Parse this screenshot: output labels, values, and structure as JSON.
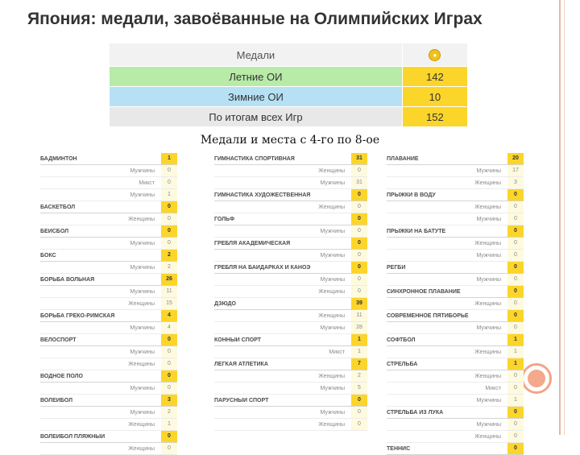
{
  "title": "Япония: медали, завоёванные на Олимпийских Играх",
  "summary": {
    "header": "Медали",
    "header_icon": "gold-medal-icon",
    "rows": [
      {
        "label": "Летние ОИ",
        "value": "142"
      },
      {
        "label": "Зимние ОИ",
        "value": "10"
      },
      {
        "label": "По итогам всех Игр",
        "value": "152"
      }
    ]
  },
  "subtitle": "Медали и места с 4-го по 8-ое",
  "columns": [
    [
      {
        "name": "Бадминтон",
        "value": "1"
      },
      {
        "name": "Мужчины",
        "value": "0"
      },
      {
        "name": "Микст",
        "value": "0"
      },
      {
        "name": "Мужчины",
        "value": "1"
      },
      {
        "name": "Баскетбол",
        "value": "0"
      },
      {
        "name": "Женщины",
        "value": "0"
      },
      {
        "name": "Бейсбол",
        "value": "0"
      },
      {
        "name": "Мужчины",
        "value": "0"
      },
      {
        "name": "Бокс",
        "value": "2"
      },
      {
        "name": "Мужчины",
        "value": "2"
      },
      {
        "name": "Борьба вольная",
        "value": "26"
      },
      {
        "name": "Мужчины",
        "value": "11"
      },
      {
        "name": "Женщины",
        "value": "15"
      },
      {
        "name": "Борьба греко-римская",
        "value": "4"
      },
      {
        "name": "Мужчины",
        "value": "4"
      },
      {
        "name": "Велоспорт",
        "value": "0"
      },
      {
        "name": "Мужчины",
        "value": "0"
      },
      {
        "name": "Женщины",
        "value": "0"
      },
      {
        "name": "Водное поло",
        "value": "0"
      },
      {
        "name": "Мужчины",
        "value": "0"
      },
      {
        "name": "Волейбол",
        "value": "3"
      },
      {
        "name": "Мужчины",
        "value": "2"
      },
      {
        "name": "Женщины",
        "value": "1"
      },
      {
        "name": "Волейбол пляжный",
        "value": "0"
      },
      {
        "name": "Женщины",
        "value": "0"
      }
    ],
    [
      {
        "name": "Гимнастика спортивная",
        "value": "31"
      },
      {
        "name": "Женщины",
        "value": "0"
      },
      {
        "name": "Мужчины",
        "value": "31"
      },
      {
        "name": "Гимнастика художественная",
        "value": "0"
      },
      {
        "name": "Женщины",
        "value": "0"
      },
      {
        "name": "Гольф",
        "value": "0"
      },
      {
        "name": "Мужчины",
        "value": "0"
      },
      {
        "name": "Гребля академическая",
        "value": "0"
      },
      {
        "name": "Мужчины",
        "value": "0"
      },
      {
        "name": "Гребля на байдарках и каноэ",
        "value": "0"
      },
      {
        "name": "Мужчины",
        "value": "0"
      },
      {
        "name": "Женщины",
        "value": "0"
      },
      {
        "name": "Дзюдо",
        "value": "39"
      },
      {
        "name": "Женщины",
        "value": "11"
      },
      {
        "name": "Мужчины",
        "value": "28"
      },
      {
        "name": "Конный спорт",
        "value": "1"
      },
      {
        "name": "Микст",
        "value": "1"
      },
      {
        "name": "Легкая атлетика",
        "value": "7"
      },
      {
        "name": "Женщины",
        "value": "2"
      },
      {
        "name": "Мужчины",
        "value": "5"
      },
      {
        "name": "Парусный спорт",
        "value": "0"
      },
      {
        "name": "Мужчины",
        "value": "0"
      },
      {
        "name": "Женщины",
        "value": "0"
      }
    ],
    [
      {
        "name": "Плавание",
        "value": "20"
      },
      {
        "name": "Мужчины",
        "value": "17"
      },
      {
        "name": "Женщины",
        "value": "3"
      },
      {
        "name": "Прыжки в воду",
        "value": "0"
      },
      {
        "name": "Женщины",
        "value": "0"
      },
      {
        "name": "Мужчины",
        "value": "0"
      },
      {
        "name": "Прыжки на батуте",
        "value": "0"
      },
      {
        "name": "Женщины",
        "value": "0"
      },
      {
        "name": "Мужчины",
        "value": "0"
      },
      {
        "name": "Регби",
        "value": "0"
      },
      {
        "name": "Мужчины",
        "value": "0"
      },
      {
        "name": "Синхронное плавание",
        "value": "0"
      },
      {
        "name": "Женщины",
        "value": "0"
      },
      {
        "name": "Современное пятиборье",
        "value": "0"
      },
      {
        "name": "Мужчины",
        "value": "0"
      },
      {
        "name": "Софтбол",
        "value": "1"
      },
      {
        "name": "Женщины",
        "value": "1"
      },
      {
        "name": "Стрельба",
        "value": "1"
      },
      {
        "name": "Женщины",
        "value": "0"
      },
      {
        "name": "Микст",
        "value": "0"
      },
      {
        "name": "Мужчины",
        "value": "1"
      },
      {
        "name": "Стрельба из лука",
        "value": "0"
      },
      {
        "name": "Мужчины",
        "value": "0"
      },
      {
        "name": "Женщины",
        "value": "0"
      },
      {
        "name": "Теннис",
        "value": "0"
      }
    ]
  ]
}
